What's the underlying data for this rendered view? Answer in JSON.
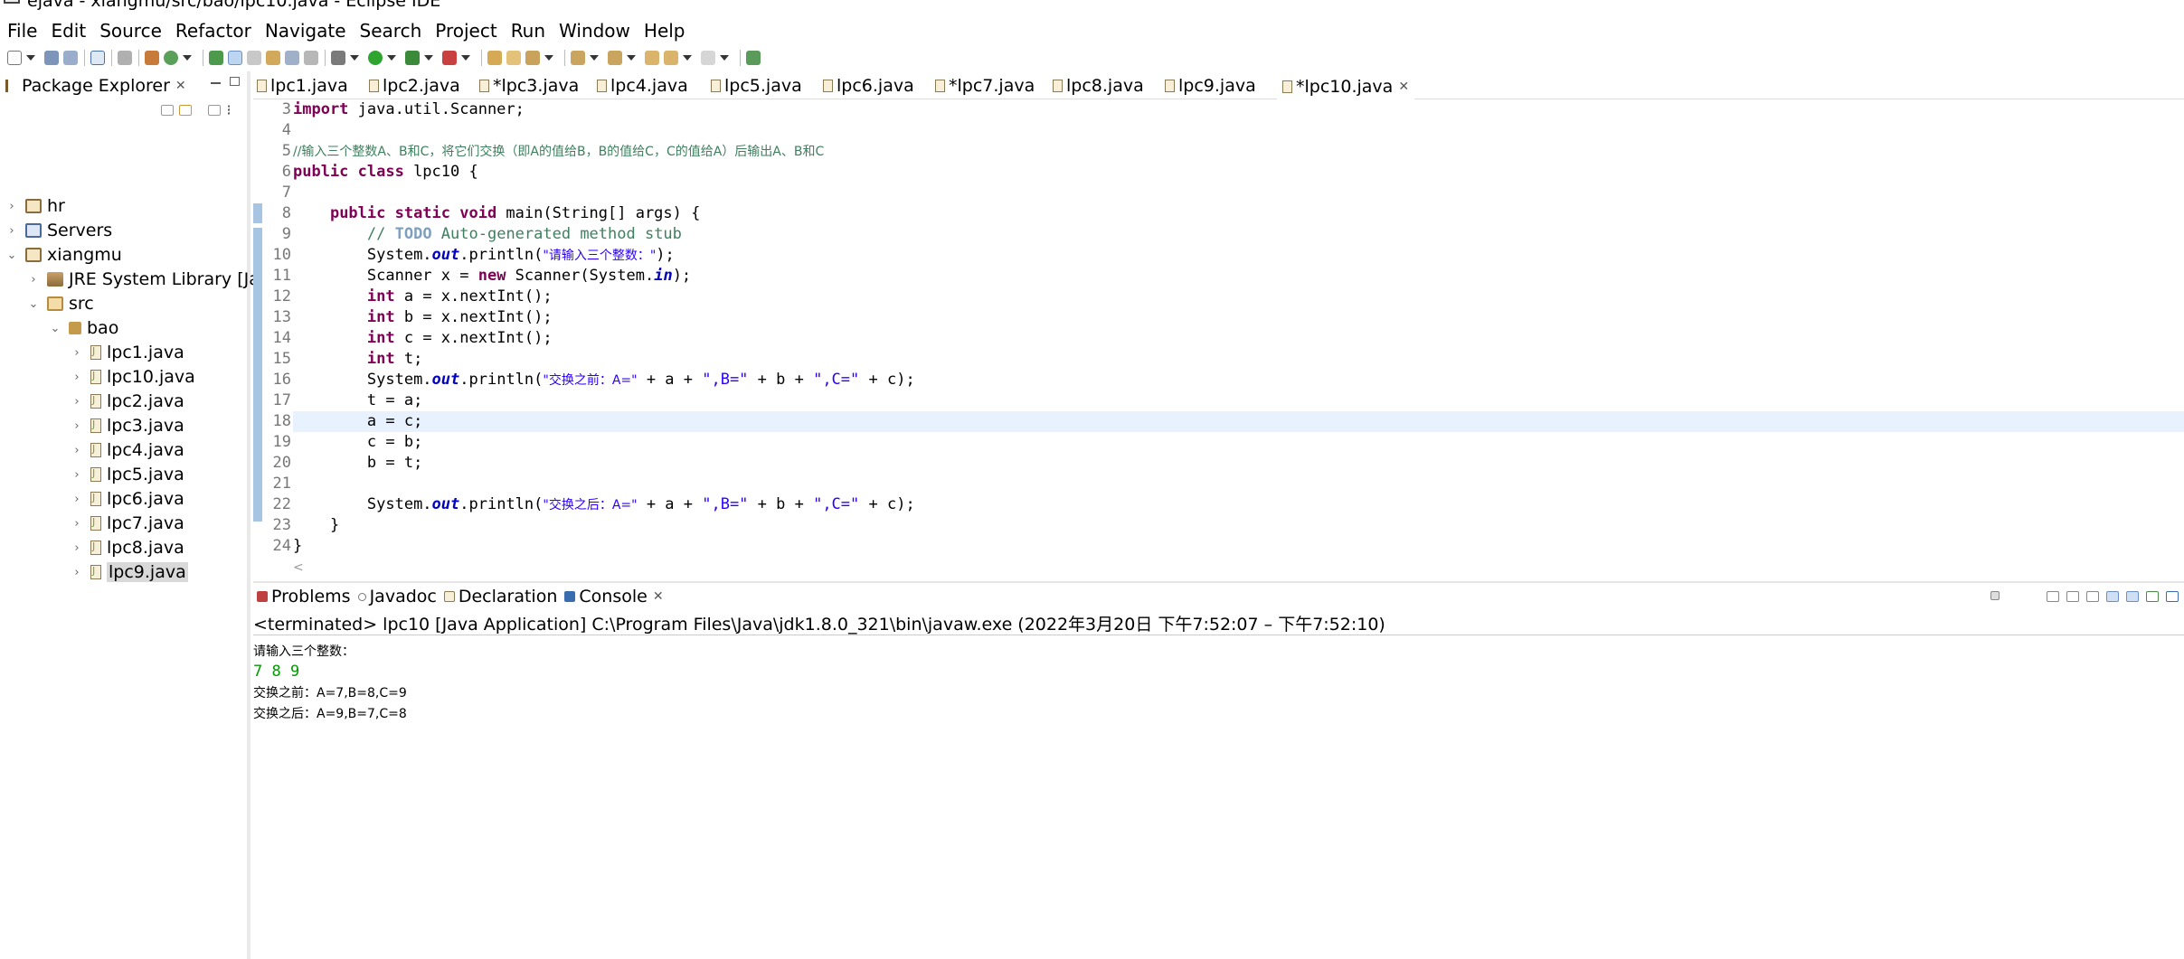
{
  "window": {
    "title": "ejava - xiangmu/src/bao/lpc10.java - Eclipse IDE"
  },
  "menu": [
    "File",
    "Edit",
    "Source",
    "Refactor",
    "Navigate",
    "Search",
    "Project",
    "Run",
    "Window",
    "Help"
  ],
  "package_explorer": {
    "title": "Package Explorer",
    "tree": {
      "hr": "hr",
      "servers": "Servers",
      "xiangmu": "xiangmu",
      "jre": "JRE System Library [Jav",
      "src": "src",
      "bao": "bao",
      "files": [
        "lpc1.java",
        "lpc10.java",
        "lpc2.java",
        "lpc3.java",
        "lpc4.java",
        "lpc5.java",
        "lpc6.java",
        "lpc7.java",
        "lpc8.java",
        "lpc9.java"
      ]
    }
  },
  "editor": {
    "tabs": [
      "lpc1.java",
      "lpc2.java",
      "*lpc3.java",
      "lpc4.java",
      "lpc5.java",
      "lpc6.java",
      "*lpc7.java",
      "lpc8.java",
      "lpc9.java",
      "*lpc10.java"
    ],
    "active_tab": "*lpc10.java",
    "line_numbers": [
      "3",
      "4",
      "5",
      "6",
      "7",
      "8",
      "9",
      "10",
      "11",
      "12",
      "13",
      "14",
      "15",
      "16",
      "17",
      "18",
      "19",
      "20",
      "21",
      "22",
      "23",
      "24"
    ],
    "code": {
      "l3_kw": "import",
      "l3_rest": " java.util.Scanner;",
      "l5": "//输入三个整数A、B和C，将它们交换（即A的值给B，B的值给C，C的值给A）后输出A、B和C",
      "l6_kw": "public class",
      "l6_rest": " lpc10 {",
      "l8_kw": "public static void",
      "l8_rest": " main(String[] args) {",
      "l9_cm": "// ",
      "l9_todo": "TODO",
      "l9_rest": " Auto-generated method stub",
      "l10_a": "System.",
      "l10_out": "out",
      "l10_b": ".println(",
      "l10_str": "\"请输入三个整数：\"",
      "l10_c": ");",
      "l11_a": "Scanner x = ",
      "l11_kw": "new",
      "l11_b": " Scanner(System.",
      "l11_in": "in",
      "l11_c": ");",
      "l12": " a = x.nextInt();",
      "l13": " b = x.nextInt();",
      "l14": " c = x.nextInt();",
      "l15": " t;",
      "int_kw": "int",
      "l16_str1": "\"交换之前：A=\"",
      "l16_str2": "\",B=\"",
      "l16_str3": "\",C=\"",
      "plus_a": " + a + ",
      "plus_b": " + b + ",
      "plus_c": " + c);",
      "l17": "t = a;",
      "l18": "a = c;",
      "l19": "c = b;",
      "l20": "b = t;",
      "l22_str1": "\"交换之后：A=\"",
      "l23": "}",
      "l24": "}"
    },
    "scroll_hint": "<"
  },
  "bottom_panel": {
    "tabs": {
      "problems": "Problems",
      "javadoc": "Javadoc",
      "declaration": "Declaration",
      "console": "Console"
    },
    "status": "<terminated> lpc10 [Java Application] C:\\Program Files\\Java\\jdk1.8.0_321\\bin\\javaw.exe  (2022年3月20日 下午7:52:07 – 下午7:52:10)",
    "output": {
      "line1": "请输入三个整数：",
      "line2": "7 8 9",
      "line3": "交换之前：A=7,B=8,C=9",
      "line4": "交换之后：A=9,B=7,C=8"
    }
  },
  "colors": {
    "keyword": "#7f0055",
    "comment": "#3f7f5f",
    "string": "#2a00ff",
    "field": "#0000c0",
    "current_line": "#e8f2fe",
    "console_input": "#009900"
  }
}
